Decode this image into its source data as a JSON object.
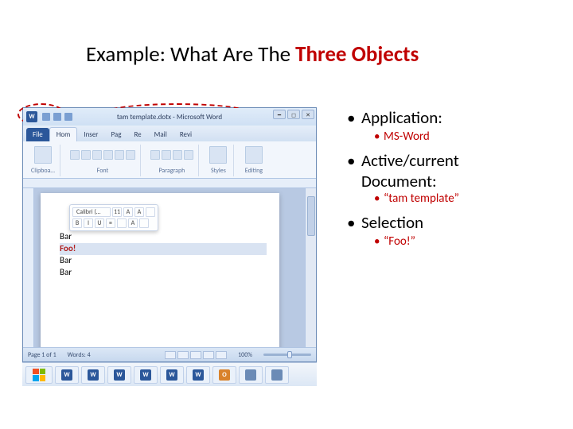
{
  "title": {
    "prefix": "Example: What Are The ",
    "highlight": "Three Objects"
  },
  "word": {
    "titlebar": "tam template.dotx - Microsoft Word",
    "tabs": {
      "file": "File",
      "home": "Hom",
      "insert": "Inser",
      "page": "Pag",
      "refs": "Re",
      "mail": "Mail",
      "review": "Revi"
    },
    "groups": {
      "clipboard": "Clipboa…",
      "font": "Font",
      "paragraph": "Paragraph",
      "styles": "Styles",
      "editing": "Editing"
    },
    "status": {
      "page": "Page 1 of 1",
      "words": "Words: 4",
      "zoom": "100%"
    },
    "mini_font": "Calibri (…",
    "doc": {
      "line1": "Bar",
      "line2": "Foo!",
      "line3": "Bar",
      "line4": "Bar"
    }
  },
  "bullets": {
    "b1": "Application:",
    "b1s": "MS-Word",
    "b2a": "Active/current",
    "b2b": "Document:",
    "b2s": "“tam template”",
    "b3": "Selection",
    "b3s": "“Foo!”"
  },
  "icons": {
    "w": "W",
    "o": "O"
  }
}
